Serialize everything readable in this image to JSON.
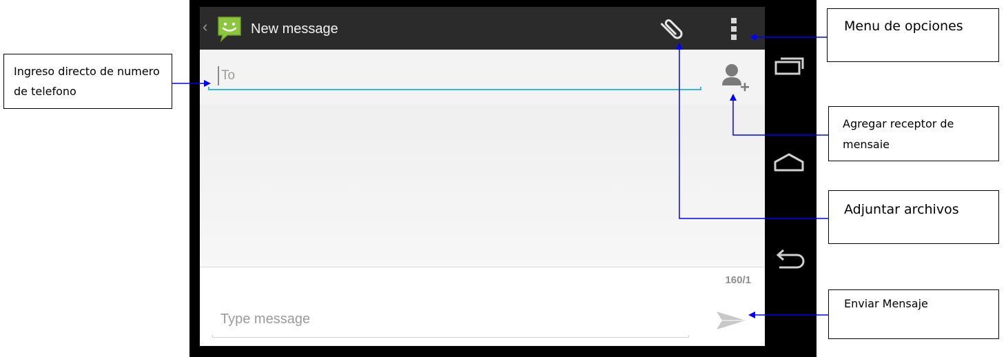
{
  "actionbar": {
    "title": "New message",
    "up_icon": "chevron-left-icon",
    "app_icon": "messaging-smiley-icon",
    "attach_icon": "paperclip-icon",
    "overflow_icon": "vertical-dots-icon"
  },
  "recipients": {
    "to_placeholder": "To",
    "to_value": "",
    "add_icon": "add-person-icon"
  },
  "compose": {
    "counter": "160/1",
    "message_placeholder": "Type message",
    "message_value": "",
    "send_icon": "send-icon"
  },
  "navbar": {
    "recents_icon": "recent-apps-icon",
    "home_icon": "home-icon",
    "back_icon": "back-icon"
  },
  "annotations": {
    "phone_entry": "Ingreso directo de numero de telefono",
    "options_menu": "Menu de opciones",
    "add_recipient": "Agregar receptor de mensaie",
    "attach_files": "Adjuntar archivos",
    "send_message": "Enviar Mensaje"
  },
  "colors": {
    "actionbar_bg": "#2b2b2b",
    "accent": "#33b5e5",
    "app_icon_green": "#8cc63f",
    "arrow": "#0000ff"
  }
}
